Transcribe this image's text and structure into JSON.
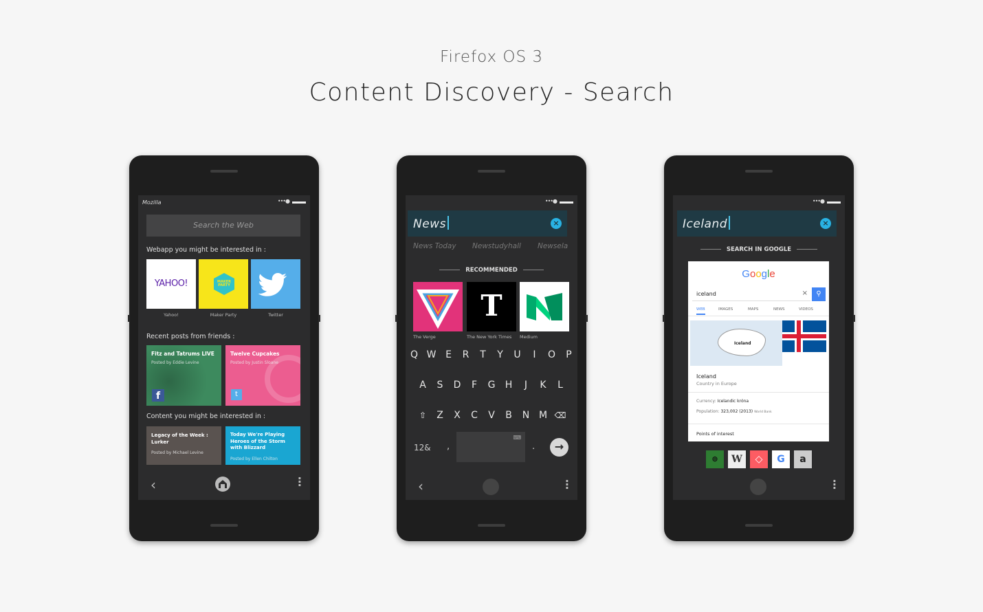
{
  "header": {
    "subtitle": "Firefox OS 3",
    "title": "Content Discovery - Search"
  },
  "phone1": {
    "carrier": "Mozilla",
    "search_placeholder": "Search the Web",
    "webapps_label": "Webapp you might be interested in :",
    "webapps": [
      {
        "label": "Yahoo!",
        "logo": "YAHOO!"
      },
      {
        "label": "Maker Party",
        "logo": "MAKER PARTY"
      },
      {
        "label": "Twitter",
        "logo": "twitter-bird-icon"
      }
    ],
    "friends_label": "Recent posts from friends :",
    "friends": [
      {
        "title": "Fitz and Tatrums LIVE",
        "by": "Posted by Eddie Levine",
        "network": "facebook-icon"
      },
      {
        "title": "Twelve Cupcakes",
        "by": "Posted by Justin Sloane",
        "network": "twitter-icon"
      }
    ],
    "content_label": "Content you might be interested in :",
    "content": [
      {
        "title": "Legacy of the Week : Lurker",
        "by": "Posted by Michael Levine"
      },
      {
        "title": "Today We're Playing Heroes of the Storm with Blizzard",
        "by": "Posted by Ellen Chilton"
      }
    ]
  },
  "phone2": {
    "query": "News",
    "suggestions": [
      "News Today",
      "Newstudyhall",
      "Newsela"
    ],
    "recommended_label": "RECOMMENDED",
    "apps": [
      {
        "label": "The Verge",
        "logo": "V",
        "color": "#e2337a"
      },
      {
        "label": "The New York Times",
        "logo": "T",
        "color": "#000000"
      },
      {
        "label": "Medium",
        "logo": "M",
        "color": "#00ab6c"
      }
    ],
    "keyboard": {
      "row1": [
        "Q",
        "W",
        "E",
        "R",
        "T",
        "Y",
        "U",
        "I",
        "O",
        "P"
      ],
      "row2": [
        "A",
        "S",
        "D",
        "F",
        "G",
        "H",
        "J",
        "K",
        "L"
      ],
      "row3": [
        "Z",
        "X",
        "C",
        "V",
        "B",
        "N",
        "M"
      ],
      "symbols_key": "12&",
      "comma": ",",
      "period": "."
    }
  },
  "phone3": {
    "query": "Iceland",
    "search_in_label": "SEARCH IN GOOGLE",
    "google": {
      "logo": "Google",
      "query": "iceland",
      "tabs": [
        "WEB",
        "IMAGES",
        "MAPS",
        "NEWS",
        "VIDEOS"
      ],
      "map_label": "Iceland",
      "entity_title": "Iceland",
      "entity_sub": "Country in Europe",
      "currency_label": "Currency:",
      "currency_value": "Icelandic króna",
      "population_label": "Population:",
      "population_value": "323,002 (2013)",
      "population_source": "World Bank",
      "poi_label": "Points of interest"
    },
    "sources": [
      "tripadvisor-icon",
      "wikipedia-icon",
      "airbnb-icon",
      "google-icon",
      "amazon-icon"
    ]
  }
}
